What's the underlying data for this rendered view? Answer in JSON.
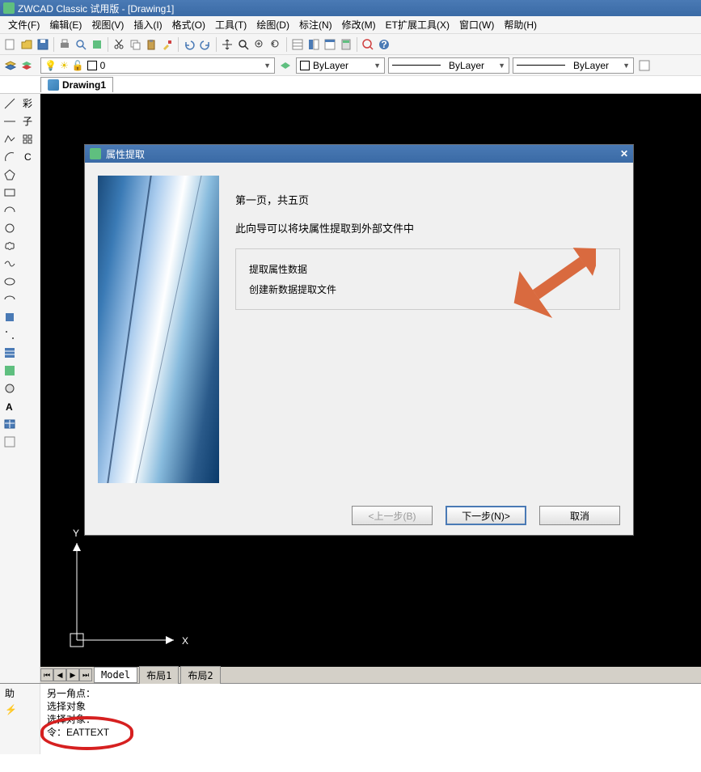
{
  "title": "ZWCAD Classic 试用版 - [Drawing1]",
  "menu": [
    "文件(F)",
    "编辑(E)",
    "视图(V)",
    "插入(I)",
    "格式(O)",
    "工具(T)",
    "绘图(D)",
    "标注(N)",
    "修改(M)",
    "ET扩展工具(X)",
    "窗口(W)",
    "帮助(H)"
  ],
  "layer": {
    "name": "0",
    "bylayer1": "ByLayer",
    "bylayer2": "ByLayer",
    "bylayer3": "ByLayer"
  },
  "doc_tab": "Drawing1",
  "model_tabs": {
    "model": "Model",
    "layout1": "布局1",
    "layout2": "布局2"
  },
  "ucs": {
    "x": "X",
    "y": "Y"
  },
  "command": {
    "line1": "另一角点：",
    "line2": "选择对象",
    "line3": "",
    "line4": "选择对象：",
    "line5": "令：EATTEXT"
  },
  "dialog": {
    "title": "属性提取",
    "page_info": "第一页，共五页",
    "description": "此向导可以将块属性提取到外部文件中",
    "option1": "提取属性数据",
    "option2": "创建新数据提取文件",
    "back": "<上一步(B)",
    "next": "下一步(N)>",
    "cancel": "取消"
  }
}
